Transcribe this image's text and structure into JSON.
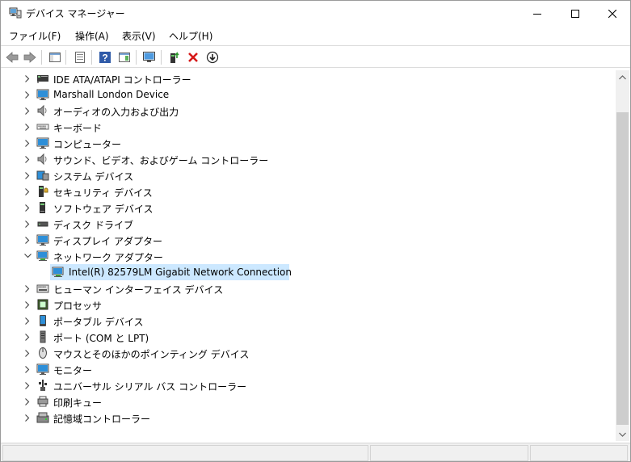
{
  "window": {
    "title": "デバイス マネージャー"
  },
  "menu": [
    "ファイル(F)",
    "操作(A)",
    "表示(V)",
    "ヘルプ(H)"
  ],
  "toolbar": {
    "back": "back-arrow-icon",
    "forward": "forward-arrow-icon",
    "properties": "properties-icon",
    "refresh": "device-list-icon",
    "help": "help-icon",
    "resources": "resources-icon",
    "monitor": "monitor-scan-icon",
    "update": "update-driver-icon",
    "uninstall": "uninstall-icon",
    "download": "download-icon"
  },
  "tree": {
    "items": [
      {
        "label": "IDE ATA/ATAPI コントローラー",
        "expanded": false
      },
      {
        "label": "Marshall London Device",
        "expanded": false
      },
      {
        "label": "オーディオの入力および出力",
        "expanded": false
      },
      {
        "label": "キーボード",
        "expanded": false
      },
      {
        "label": "コンピューター",
        "expanded": false
      },
      {
        "label": "サウンド、ビデオ、およびゲーム コントローラー",
        "expanded": false
      },
      {
        "label": "システム デバイス",
        "expanded": false
      },
      {
        "label": "セキュリティ デバイス",
        "expanded": false
      },
      {
        "label": "ソフトウェア デバイス",
        "expanded": false
      },
      {
        "label": "ディスク ドライブ",
        "expanded": false
      },
      {
        "label": "ディスプレイ アダプター",
        "expanded": false
      },
      {
        "label": "ネットワーク アダプター",
        "expanded": true
      },
      {
        "label": "Intel(R) 82579LM Gigabit Network Connection",
        "child": true,
        "selected": true
      },
      {
        "label": "ヒューマン インターフェイス デバイス",
        "expanded": false
      },
      {
        "label": "プロセッサ",
        "expanded": false
      },
      {
        "label": "ポータブル デバイス",
        "expanded": false
      },
      {
        "label": "ポート (COM と LPT)",
        "expanded": false
      },
      {
        "label": "マウスとそのほかのポインティング デバイス",
        "expanded": false
      },
      {
        "label": "モニター",
        "expanded": false
      },
      {
        "label": "ユニバーサル シリアル バス コントローラー",
        "expanded": false
      },
      {
        "label": "印刷キュー",
        "expanded": false
      },
      {
        "label": "記憶域コントローラー",
        "expanded": false
      }
    ]
  }
}
